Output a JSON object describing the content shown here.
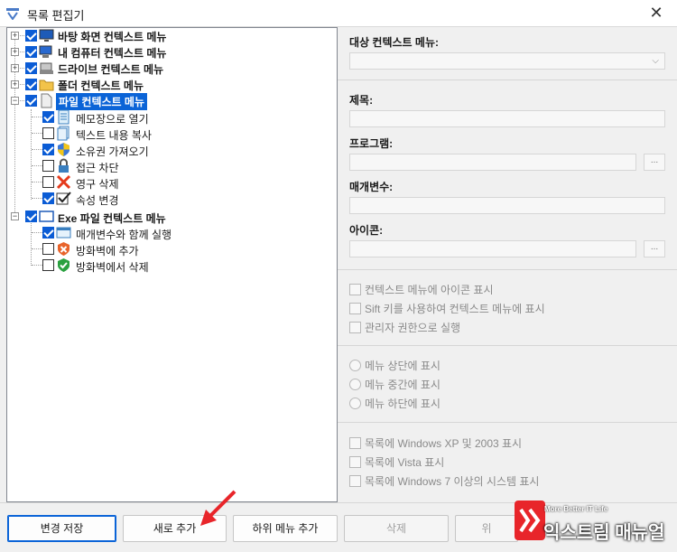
{
  "window": {
    "title": "목록 편집기"
  },
  "tree": {
    "items": [
      {
        "label": "바탕 화면 컨텍스트 메뉴",
        "checked": true,
        "bold": true,
        "icon": "desktop-icon"
      },
      {
        "label": "내 컴퓨터 컨텍스트 메뉴",
        "checked": true,
        "bold": true,
        "icon": "computer-icon"
      },
      {
        "label": "드라이브 컨텍스트 메뉴",
        "checked": true,
        "bold": true,
        "icon": "drive-icon"
      },
      {
        "label": "폴더 컨텍스트 메뉴",
        "checked": true,
        "bold": true,
        "icon": "folder-icon"
      },
      {
        "label": "파일 컨텍스트 메뉴",
        "checked": true,
        "bold": true,
        "selected": true,
        "icon": "file-icon",
        "children": [
          {
            "label": "메모장으로 열기",
            "checked": true,
            "icon": "notepad-icon"
          },
          {
            "label": "텍스트 내용 복사",
            "checked": false,
            "icon": "text-copy-icon"
          },
          {
            "label": "소유권 가져오기",
            "checked": true,
            "icon": "shield-uac-icon"
          },
          {
            "label": "접근 차단",
            "checked": false,
            "icon": "lock-icon"
          },
          {
            "label": "영구 삭제",
            "checked": false,
            "icon": "red-x-icon"
          },
          {
            "label": "속성 변경",
            "checked": true,
            "icon": "checkbox-icon"
          }
        ]
      },
      {
        "label": "Exe 파일 컨텍스트 메뉴",
        "checked": true,
        "bold": true,
        "icon": "exe-window-icon",
        "children": [
          {
            "label": "매개변수와 함께 실행",
            "checked": true,
            "icon": "window-run-icon"
          },
          {
            "label": "방화벽에 추가",
            "checked": false,
            "icon": "firewall-add-icon"
          },
          {
            "label": "방화벽에서 삭제",
            "checked": false,
            "icon": "firewall-remove-icon"
          }
        ]
      }
    ]
  },
  "form": {
    "target_label": "대상 컨텍스트 메뉴:",
    "title_label": "제목:",
    "program_label": "프로그램:",
    "params_label": "매개변수:",
    "icon_label": "아이콘:",
    "browse_label": "...",
    "options_group1": [
      "컨텍스트 메뉴에 아이콘 표시",
      "Sift 키를 사용하여 컨텍스트 메뉴에 표시",
      "관리자 권한으로 실행"
    ],
    "options_group2": [
      "메뉴 상단에 표시",
      "메뉴 중간에 표시",
      "메뉴 하단에 표시"
    ],
    "options_group3": [
      "목록에 Windows XP 및 2003 표시",
      "목록에 Vista 표시",
      "목록에 Windows 7 이상의 시스템 표시"
    ]
  },
  "buttons": {
    "save": "변경 저장",
    "add_new": "새로 추가",
    "add_submenu": "하위 메뉴 추가",
    "delete": "삭제",
    "partial": "위"
  },
  "watermark": {
    "tagline": "More Better IT Life",
    "brand": "익스트림 매뉴얼"
  },
  "colors": {
    "accent": "#0b64d7",
    "arrow": "#e8252a"
  }
}
